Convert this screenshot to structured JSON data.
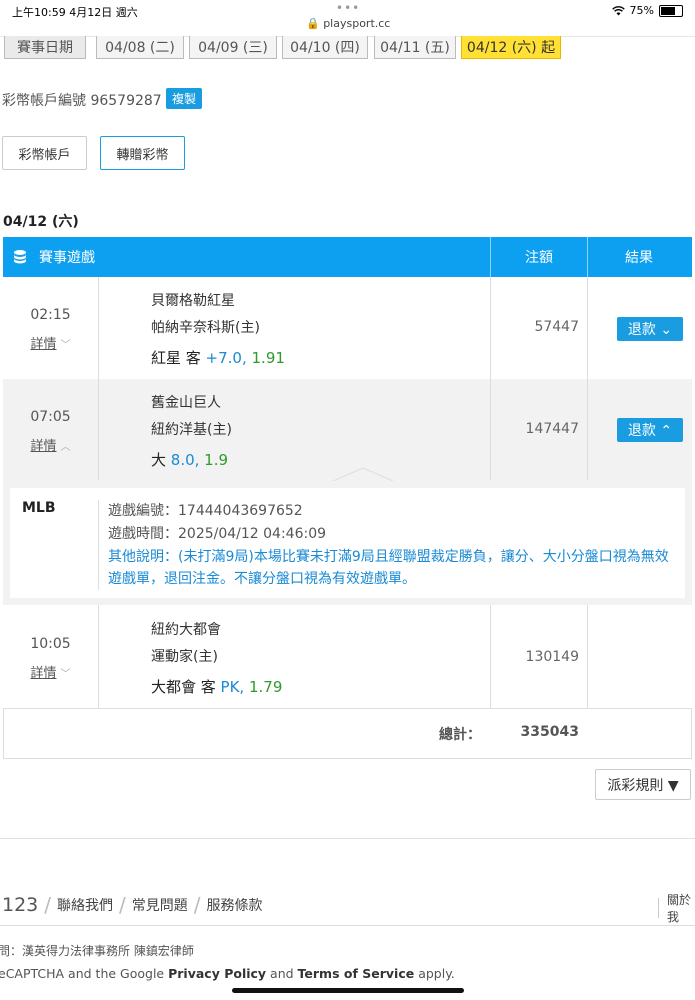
{
  "status_bar": {
    "time": "上午10:59  4月12日 週六",
    "dots": "•••",
    "url": "🔒 playsport.cc",
    "wifi_icon": "wifi-icon",
    "battery": "75%"
  },
  "dates": {
    "label": "賽事日期",
    "tabs": [
      "04/08 (二)",
      "04/09 (三)",
      "04/10 (四)",
      "04/11 (五)",
      "04/12 (六) 起"
    ],
    "active_index": 4
  },
  "account": {
    "label": "彩幣帳戶編號 96579287",
    "copy": "複製"
  },
  "buttons": {
    "account": "彩幣帳戶",
    "transfer": "轉贈彩幣"
  },
  "day_title": "04/12 (六)",
  "table": {
    "headers": {
      "game": "賽事遊戲",
      "amount": "注額",
      "result": "結果"
    },
    "rows": [
      {
        "time": "02:15",
        "detail": "詳情",
        "chev": "﹀",
        "team1": "貝爾格勒紅星",
        "team2": "帕納辛奈科斯(主)",
        "pick_main": "紅星 客 ",
        "pick_line": "+7.0,",
        "pick_odds": " 1.91",
        "amount": "57447",
        "refund": "退款 ⌄"
      },
      {
        "time": "07:05",
        "detail": "詳情",
        "chev": "︿",
        "team1": "舊金山巨人",
        "team2": "紐約洋基(主)",
        "pick_main": "大 ",
        "pick_line": "8.0,",
        "pick_odds": " 1.9",
        "amount": "147447",
        "refund": "退款 ⌃"
      },
      {
        "time": "10:05",
        "detail": "詳情",
        "chev": "﹀",
        "team1": "紐約大都會",
        "team2": "運動家(主)",
        "pick_main": "大都會 客 ",
        "pick_line": "PK,",
        "pick_odds": " 1.79",
        "amount": "130149"
      }
    ],
    "expanded": {
      "league": "MLB",
      "game_id": "遊戲編號：17444043697652",
      "game_time": "遊戲時間：2025/04/12 04:46:09",
      "note": "其他說明：(未打滿9局)本場比賽未打滿9局且經聯盟裁定勝負，讓分、大小分盤口視為無效遊戲單，退回注金。不讓分盤口視為有效遊戲單。"
    },
    "total_label": "總計：",
    "total_value": "335043"
  },
  "rules_button": "派彩規則 ▼",
  "footer": {
    "num": "123",
    "links": [
      "聯絡我們",
      "常見問題",
      "服務條款"
    ],
    "about": "關於我",
    "legal": "問：漢英得力法律事務所 陳鎮宏律師",
    "recaptcha_pre": "eCAPTCHA and the Google ",
    "privacy": "Privacy Policy",
    "and": " and ",
    "terms": "Terms of Service",
    "apply": " apply."
  },
  "colors": {
    "accent": "#1a9ce0",
    "header_bg": "#0da0f0",
    "active_tab": "#ffe033",
    "odds_green": "#2e9a2e"
  }
}
